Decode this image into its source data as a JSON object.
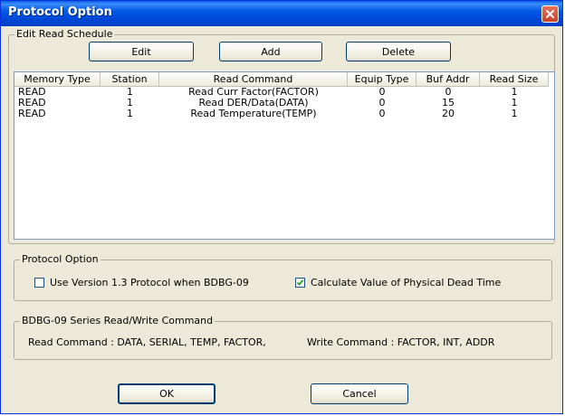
{
  "window": {
    "title": "Protocol Option"
  },
  "schedule": {
    "legend": "Edit Read Schedule",
    "edit_label": "Edit",
    "add_label": "Add",
    "delete_label": "Delete",
    "columns": [
      "Memory Type",
      "Station",
      "Read Command",
      "Equip Type",
      "Buf Addr",
      "Read Size"
    ],
    "rows": [
      [
        "READ",
        "1",
        "Read Curr Factor(FACTOR)",
        "0",
        "0",
        "1"
      ],
      [
        "READ",
        "1",
        "Read DER/Data(DATA)",
        "0",
        "15",
        "1"
      ],
      [
        "READ",
        "1",
        "Read Temperature(TEMP)",
        "0",
        "20",
        "1"
      ]
    ]
  },
  "protocol": {
    "legend": "Protocol Option",
    "version_label": "Use Version 1.3 Protocol when BDBG-09",
    "version_checked": false,
    "dead_time_label": "Calculate Value of Physical Dead Time",
    "dead_time_checked": true
  },
  "commands": {
    "legend": "BDBG-09 Series Read/Write Command",
    "read_text": "Read Command : DATA, SERIAL, TEMP, FACTOR,",
    "write_text": "Write Command : FACTOR, INT, ADDR"
  },
  "footer": {
    "ok_label": "OK",
    "cancel_label": "Cancel"
  }
}
